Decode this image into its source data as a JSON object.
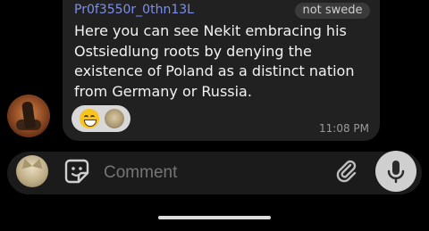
{
  "message": {
    "sender_name": "Pr0f3550r_0thn13L",
    "tag": "not swede",
    "text": "Here you can see Nekit embracing his Ostsiedlung roots by denying the existence of Poland as a distinct nation from Germany or Russia.",
    "time": "11:08 PM",
    "reaction_emoji": "grinning-face-smiling-eyes"
  },
  "composer": {
    "placeholder": "Comment"
  },
  "icons": {
    "sticker": "sticker-smile-icon",
    "attach": "paperclip-icon",
    "mic": "microphone-icon"
  },
  "colors": {
    "sender_name": "#7c8ff0",
    "bubble": "#212121",
    "mic_button": "#cfcfcf"
  }
}
